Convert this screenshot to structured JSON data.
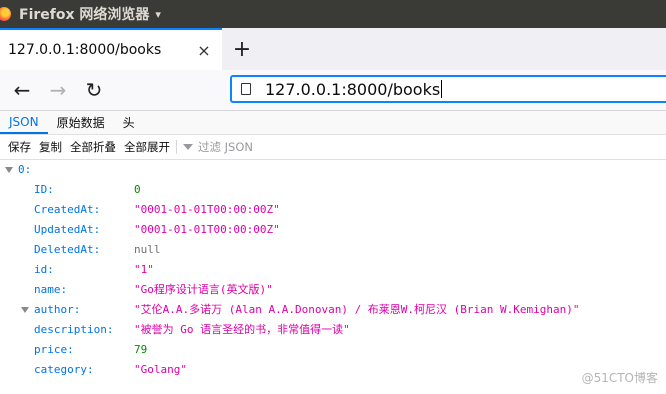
{
  "window": {
    "title": "Firefox 网络浏览器",
    "caret": "▾"
  },
  "tab": {
    "title": "127.0.0.1:8000/books",
    "close": "×"
  },
  "newtab": {
    "label": "+"
  },
  "nav": {
    "back": "←",
    "forward": "→",
    "reload": "↻"
  },
  "urlbar": {
    "value": "127.0.0.1:8000/books"
  },
  "viewer_tabs": [
    "JSON",
    "原始数据",
    "头"
  ],
  "toolbar": {
    "save": "保存",
    "copy": "复制",
    "collapse_all": "全部折叠",
    "expand_all": "全部展开",
    "filter_placeholder": "过滤 JSON"
  },
  "json": {
    "root_key": "0:",
    "rows": [
      {
        "key": "ID:",
        "value": "0",
        "type": "number"
      },
      {
        "key": "CreatedAt:",
        "value": "\"0001-01-01T00:00:00Z\"",
        "type": "string"
      },
      {
        "key": "UpdatedAt:",
        "value": "\"0001-01-01T00:00:00Z\"",
        "type": "string"
      },
      {
        "key": "DeletedAt:",
        "value": "null",
        "type": "null"
      },
      {
        "key": "id:",
        "value": "\"1\"",
        "type": "string"
      },
      {
        "key": "name:",
        "value": "\"Go程序设计语言(英文版)\"",
        "type": "string"
      },
      {
        "key": "author:",
        "value": "\"艾伦A.A.多诺万 (Alan A.A.Donovan) / 布莱恩W.柯尼汉 (Brian W.Kemighan)\"",
        "type": "string",
        "expandable": true
      },
      {
        "key": "description:",
        "value": "\"被誉为 Go 语言圣经的书，非常值得一读\"",
        "type": "string"
      },
      {
        "key": "price:",
        "value": "79",
        "type": "number"
      },
      {
        "key": "category:",
        "value": "\"Golang\"",
        "type": "string"
      }
    ]
  },
  "watermark": "@51CTO博客",
  "colors": {
    "accent": "#0074e8",
    "key": "#0074e8",
    "string": "#dd00a9",
    "number": "#058b00",
    "titlebar": "#3a3a37"
  }
}
